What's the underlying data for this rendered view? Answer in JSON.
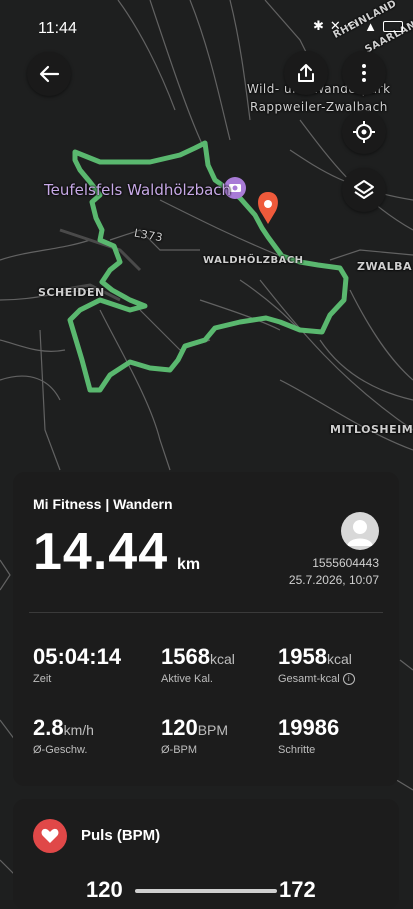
{
  "status_bar": {
    "time": "11:44"
  },
  "map": {
    "labels": {
      "teufelsfels": "Teufelsfels Waldhölzbach",
      "waldhoelzbach": "WALDHÖLZBACH",
      "scheiden": "SCHEIDEN",
      "zwalbach": "ZWALBA",
      "mitlosheim": "MITLOSHEIM",
      "road": "L373",
      "wildpark": "Wild- und Wanderpark",
      "rappweiler": "Rappweiler-Zwalbach",
      "saarland": "SAARLAND",
      "rheinland": "RHEINLAND"
    },
    "route_color": "#5ab86f",
    "marker_color": "#ef5a3b"
  },
  "activity": {
    "source": "Mi Fitness | Wandern",
    "distance": "14.44",
    "distance_unit": "km",
    "user_id": "1555604443",
    "datetime": "25.7.2026, 10:07",
    "stats": {
      "zeit": {
        "value": "05:04:14",
        "unit": "",
        "label": "Zeit"
      },
      "aktive_kal": {
        "value": "1568",
        "unit": "kcal",
        "label": "Aktive Kal."
      },
      "gesamt_kcal": {
        "value": "1958",
        "unit": "kcal",
        "label": "Gesamt-kcal"
      },
      "geschw": {
        "value": "2.8",
        "unit": "km/h",
        "label": "Ø-Geschw."
      },
      "bpm": {
        "value": "120",
        "unit": "BPM",
        "label": "Ø-BPM"
      },
      "schritte": {
        "value": "19986",
        "unit": "",
        "label": "Schritte"
      }
    }
  },
  "puls": {
    "title": "Puls (BPM)",
    "min": "120",
    "max": "172"
  }
}
